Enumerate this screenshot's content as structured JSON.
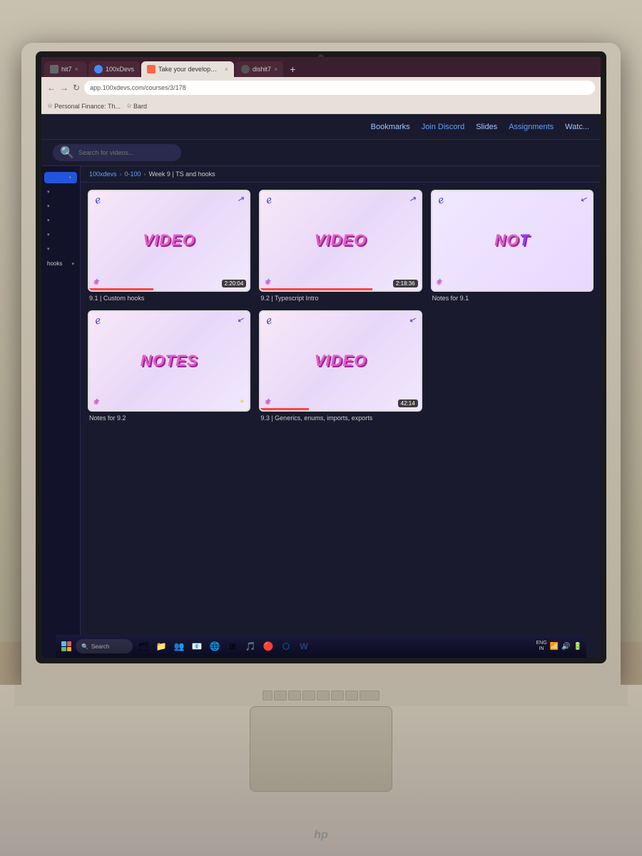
{
  "room": {
    "bg_top": "#c8c0b0",
    "bg_bottom": "#988870"
  },
  "browser": {
    "tabs": [
      {
        "id": "tab1",
        "label": "hit7",
        "favicon_color": "#888",
        "active": false
      },
      {
        "id": "tab2",
        "label": "100xDevs",
        "favicon_color": "#4488ff",
        "active": false
      },
      {
        "id": "tab3",
        "label": "Take your development skills",
        "favicon_color": "#ff6644",
        "active": true
      },
      {
        "id": "tab4",
        "label": "dishit7",
        "favicon_color": "#555",
        "active": false
      }
    ],
    "url": "app.100xdevs.com/courses/3/178",
    "bookmarks": [
      {
        "label": "Personal Finance: Th..."
      },
      {
        "label": "Bard"
      }
    ]
  },
  "app": {
    "nav_links": [
      {
        "label": "Bookmarks",
        "highlighted": false
      },
      {
        "label": "Join Discord",
        "highlighted": true
      },
      {
        "label": "Slides",
        "highlighted": false
      },
      {
        "label": "Assignments",
        "highlighted": true
      },
      {
        "label": "Watc...",
        "highlighted": false
      }
    ],
    "search_placeholder": "Search for videos...",
    "breadcrumb": {
      "parts": [
        "100xdevs",
        "0-100",
        "Week 9 | TS and hooks"
      ]
    },
    "sidebar_items": [
      {
        "label": "",
        "active": true
      },
      {
        "label": ""
      },
      {
        "label": ""
      },
      {
        "label": ""
      },
      {
        "label": ""
      },
      {
        "label": ""
      },
      {
        "label": "hooks"
      }
    ],
    "video_cards": [
      {
        "id": "card1",
        "type": "VIDEO",
        "duration": "2:20:04",
        "title": "9.1 | Custom hooks",
        "has_progress": true
      },
      {
        "id": "card2",
        "type": "VIDEO",
        "duration": "2:18:36",
        "title": "9.2 | Typescript Intro",
        "has_progress": true
      },
      {
        "id": "card3",
        "type": "NOTES",
        "duration": null,
        "title": "Notes for 9.1",
        "has_progress": false
      },
      {
        "id": "card4",
        "type": "NOTES",
        "duration": null,
        "title": "Notes for 9.2",
        "has_progress": false
      },
      {
        "id": "card5",
        "type": "VIDEO",
        "duration": "42:14",
        "title": "9.3 | Generics, enums, imports, exports",
        "has_progress": true
      }
    ]
  },
  "taskbar": {
    "search_placeholder": "Search",
    "sys_text": "ENG\nIN",
    "icons": [
      "🗂",
      "📁",
      "👥",
      "📧",
      "🌐",
      "⚙",
      "🎮",
      "🎵",
      "🔴",
      "💻",
      "📝",
      "🔷"
    ]
  },
  "hp_logo": "hp"
}
